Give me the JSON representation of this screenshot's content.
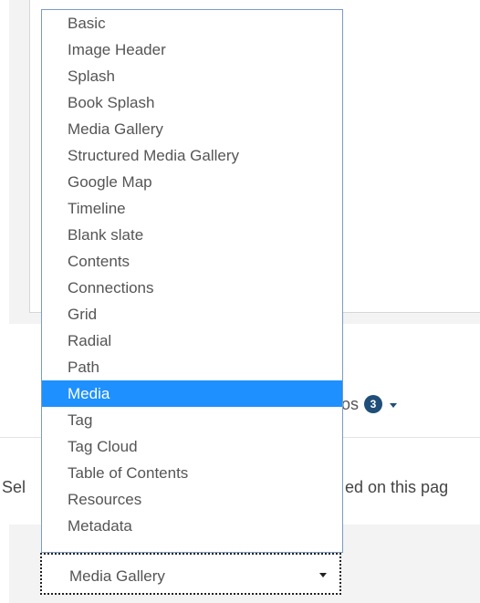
{
  "dropdown": {
    "options": [
      "Basic",
      "Image Header",
      "Splash",
      "Book Splash",
      "Media Gallery",
      "Structured Media Gallery",
      "Google Map",
      "Timeline",
      "Blank slate",
      "Contents",
      "Connections",
      "Grid",
      "Radial",
      "Path",
      "Media",
      "Tag",
      "Tag Cloud",
      "Table of Contents",
      "Resources",
      "Metadata"
    ],
    "highlighted": "Media"
  },
  "tabs_fragment": {
    "text": "os",
    "badge_count": "3"
  },
  "select_line": {
    "left_fragment": "Sel",
    "right_fragment": "ed on this pag"
  },
  "layout_select": {
    "value": "Media Gallery"
  },
  "colors": {
    "highlight": "#1e90ff",
    "badge": "#1f4e79",
    "dropdown_border": "#7a9cc6"
  }
}
